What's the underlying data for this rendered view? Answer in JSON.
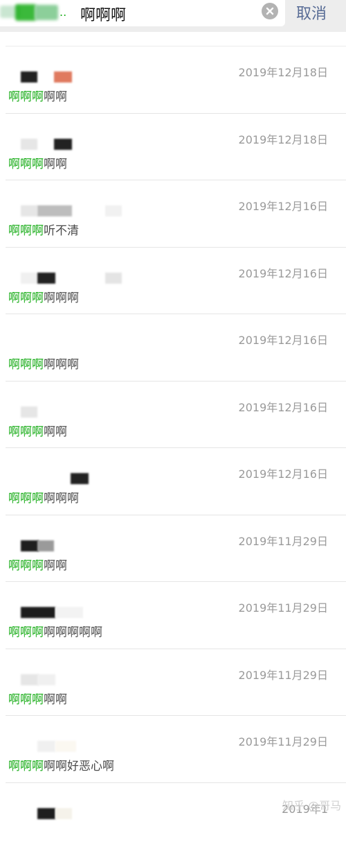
{
  "search": {
    "query": "啊啊啊",
    "cancel_label": "取消",
    "filter_tag_dots": ".."
  },
  "results": [
    {
      "date": "2019年12月18日",
      "highlight": "啊啊啊",
      "rest": "啊啊"
    },
    {
      "date": "2019年12月18日",
      "highlight": "啊啊啊",
      "rest": "啊啊"
    },
    {
      "date": "2019年12月16日",
      "highlight": "啊啊啊",
      "rest": "听不清"
    },
    {
      "date": "2019年12月16日",
      "highlight": "啊啊啊",
      "rest": "啊啊啊"
    },
    {
      "date": "2019年12月16日",
      "highlight": "啊啊啊",
      "rest": "啊啊啊"
    },
    {
      "date": "2019年12月16日",
      "highlight": "啊啊啊",
      "rest": "啊啊"
    },
    {
      "date": "2019年12月16日",
      "highlight": "啊啊啊",
      "rest": "啊啊啊"
    },
    {
      "date": "2019年11月29日",
      "highlight": "啊啊啊",
      "rest": "啊啊"
    },
    {
      "date": "2019年11月29日",
      "highlight": "啊啊啊",
      "rest": "啊啊啊啊啊"
    },
    {
      "date": "2019年11月29日",
      "highlight": "啊啊啊",
      "rest": "啊啊"
    },
    {
      "date": "2019年11月29日",
      "highlight": "啊啊啊",
      "rest": "啊啊好恶心啊"
    },
    {
      "date": "2019年1",
      "highlight": "",
      "rest": ""
    }
  ],
  "watermark": "知乎 @哥马",
  "colors": {
    "highlight": "#1aad19",
    "cancel": "#576b95",
    "date": "#9a9a9a"
  },
  "icons": {
    "clear": "clear-circle-icon"
  }
}
